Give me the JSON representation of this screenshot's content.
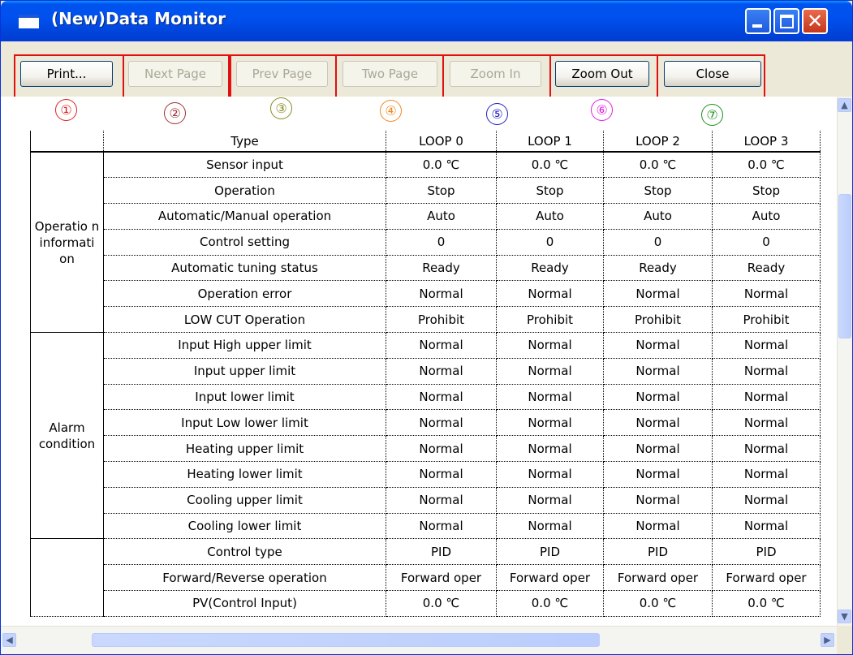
{
  "window": {
    "title": "(New)Data Monitor"
  },
  "toolbar": {
    "buttons": [
      {
        "label": "Print...",
        "enabled": true
      },
      {
        "label": "Next Page",
        "enabled": false
      },
      {
        "label": "Prev Page",
        "enabled": false
      },
      {
        "label": "Two Page",
        "enabled": false
      },
      {
        "label": "Zoom In",
        "enabled": false
      },
      {
        "label": "Zoom Out",
        "enabled": true
      },
      {
        "label": "Close",
        "enabled": true
      }
    ],
    "callouts": [
      {
        "num": "①",
        "color": "#e02020"
      },
      {
        "num": "②",
        "color": "#a03030"
      },
      {
        "num": "③",
        "color": "#8a8a20"
      },
      {
        "num": "④",
        "color": "#f08a20"
      },
      {
        "num": "⑤",
        "color": "#2020c0"
      },
      {
        "num": "⑥",
        "color": "#e020e0"
      },
      {
        "num": "⑦",
        "color": "#209020"
      }
    ]
  },
  "table": {
    "headers": [
      "Type",
      "LOOP 0",
      "LOOP 1",
      "LOOP 2",
      "LOOP 3"
    ],
    "groups": [
      {
        "name": "Operatio n informati on",
        "rows": [
          {
            "type": "Sensor input",
            "values": [
              "0.0 ℃",
              "0.0 ℃",
              "0.0 ℃",
              "0.0 ℃"
            ]
          },
          {
            "type": "Operation",
            "values": [
              "Stop",
              "Stop",
              "Stop",
              "Stop"
            ]
          },
          {
            "type": "Automatic/Manual operation",
            "values": [
              "Auto",
              "Auto",
              "Auto",
              "Auto"
            ]
          },
          {
            "type": "Control setting",
            "values": [
              "0",
              "0",
              "0",
              "0"
            ]
          },
          {
            "type": "Automatic tuning status",
            "values": [
              "Ready",
              "Ready",
              "Ready",
              "Ready"
            ]
          },
          {
            "type": "Operation error",
            "values": [
              "Normal",
              "Normal",
              "Normal",
              "Normal"
            ]
          },
          {
            "type": "LOW CUT Operation",
            "values": [
              "Prohibit",
              "Prohibit",
              "Prohibit",
              "Prohibit"
            ]
          }
        ]
      },
      {
        "name": "Alarm condition",
        "rows": [
          {
            "type": "Input High upper limit",
            "values": [
              "Normal",
              "Normal",
              "Normal",
              "Normal"
            ]
          },
          {
            "type": "Input upper limit",
            "values": [
              "Normal",
              "Normal",
              "Normal",
              "Normal"
            ]
          },
          {
            "type": "Input lower limit",
            "values": [
              "Normal",
              "Normal",
              "Normal",
              "Normal"
            ]
          },
          {
            "type": "Input Low lower limit",
            "values": [
              "Normal",
              "Normal",
              "Normal",
              "Normal"
            ]
          },
          {
            "type": "Heating upper limit",
            "values": [
              "Normal",
              "Normal",
              "Normal",
              "Normal"
            ]
          },
          {
            "type": "Heating lower limit",
            "values": [
              "Normal",
              "Normal",
              "Normal",
              "Normal"
            ]
          },
          {
            "type": "Cooling upper limit",
            "values": [
              "Normal",
              "Normal",
              "Normal",
              "Normal"
            ]
          },
          {
            "type": "Cooling lower limit",
            "values": [
              "Normal",
              "Normal",
              "Normal",
              "Normal"
            ]
          }
        ]
      },
      {
        "name": "",
        "rows": [
          {
            "type": "Control type",
            "values": [
              "PID",
              "PID",
              "PID",
              "PID"
            ]
          },
          {
            "type": "Forward/Reverse operation",
            "values": [
              "Forward oper",
              "Forward oper",
              "Forward oper",
              "Forward oper"
            ]
          },
          {
            "type": "PV(Control Input)",
            "values": [
              "0.0 ℃",
              "0.0 ℃",
              "0.0 ℃",
              "0.0 ℃"
            ]
          }
        ]
      }
    ]
  },
  "scrollbars": {
    "vertical_position": 0.23,
    "horizontal_position": 0.25
  }
}
